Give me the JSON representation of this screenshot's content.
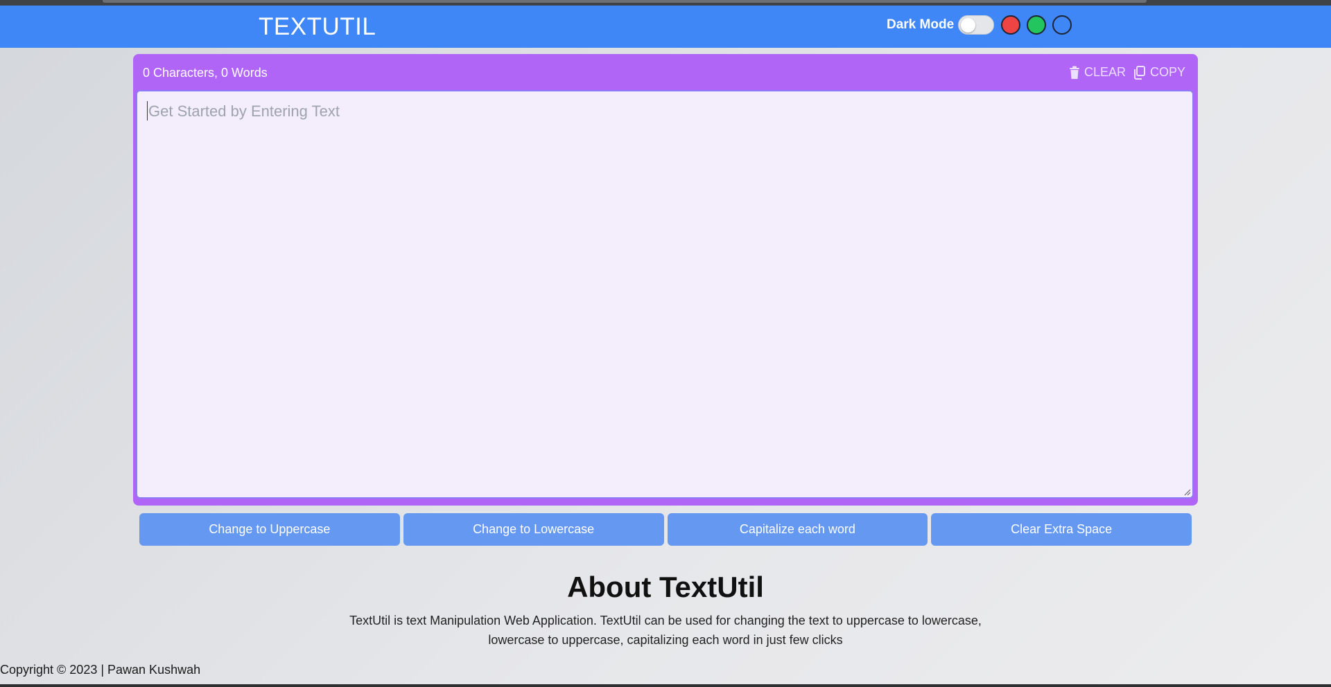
{
  "app": {
    "brand": "TEXTUTIL"
  },
  "header": {
    "dark_mode_label": "Dark Mode",
    "dark_mode_enabled": false,
    "color_swatches": [
      {
        "name": "red",
        "color": "#ef4444"
      },
      {
        "name": "green",
        "color": "#22c55e"
      },
      {
        "name": "blue",
        "color": "#3f86f6"
      }
    ]
  },
  "editor": {
    "counts": "0 Characters, 0 Words",
    "clear_label": "CLEAR",
    "copy_label": "COPY",
    "placeholder": "Get Started by Entering Text",
    "value": ""
  },
  "actions": [
    {
      "label": "Change to Uppercase"
    },
    {
      "label": "Change to Lowercase"
    },
    {
      "label": "Capitalize each word"
    },
    {
      "label": "Clear Extra Space"
    }
  ],
  "about": {
    "title": "About TextUtil",
    "line1": "TextUtil is text Manipulation Web Application. TextUtil can be used for changing the text to uppercase to lowercase,",
    "line2": "lowercase to uppercase, capitalizing each word in just few clicks"
  },
  "footer": {
    "copyright": "Copyright © 2023 | Pawan Kushwah"
  },
  "colors": {
    "navbar": "#3f86f6",
    "editor_card": "#b165f7",
    "textarea_bg": "#f3edfc",
    "action_button": "#6598f0"
  }
}
